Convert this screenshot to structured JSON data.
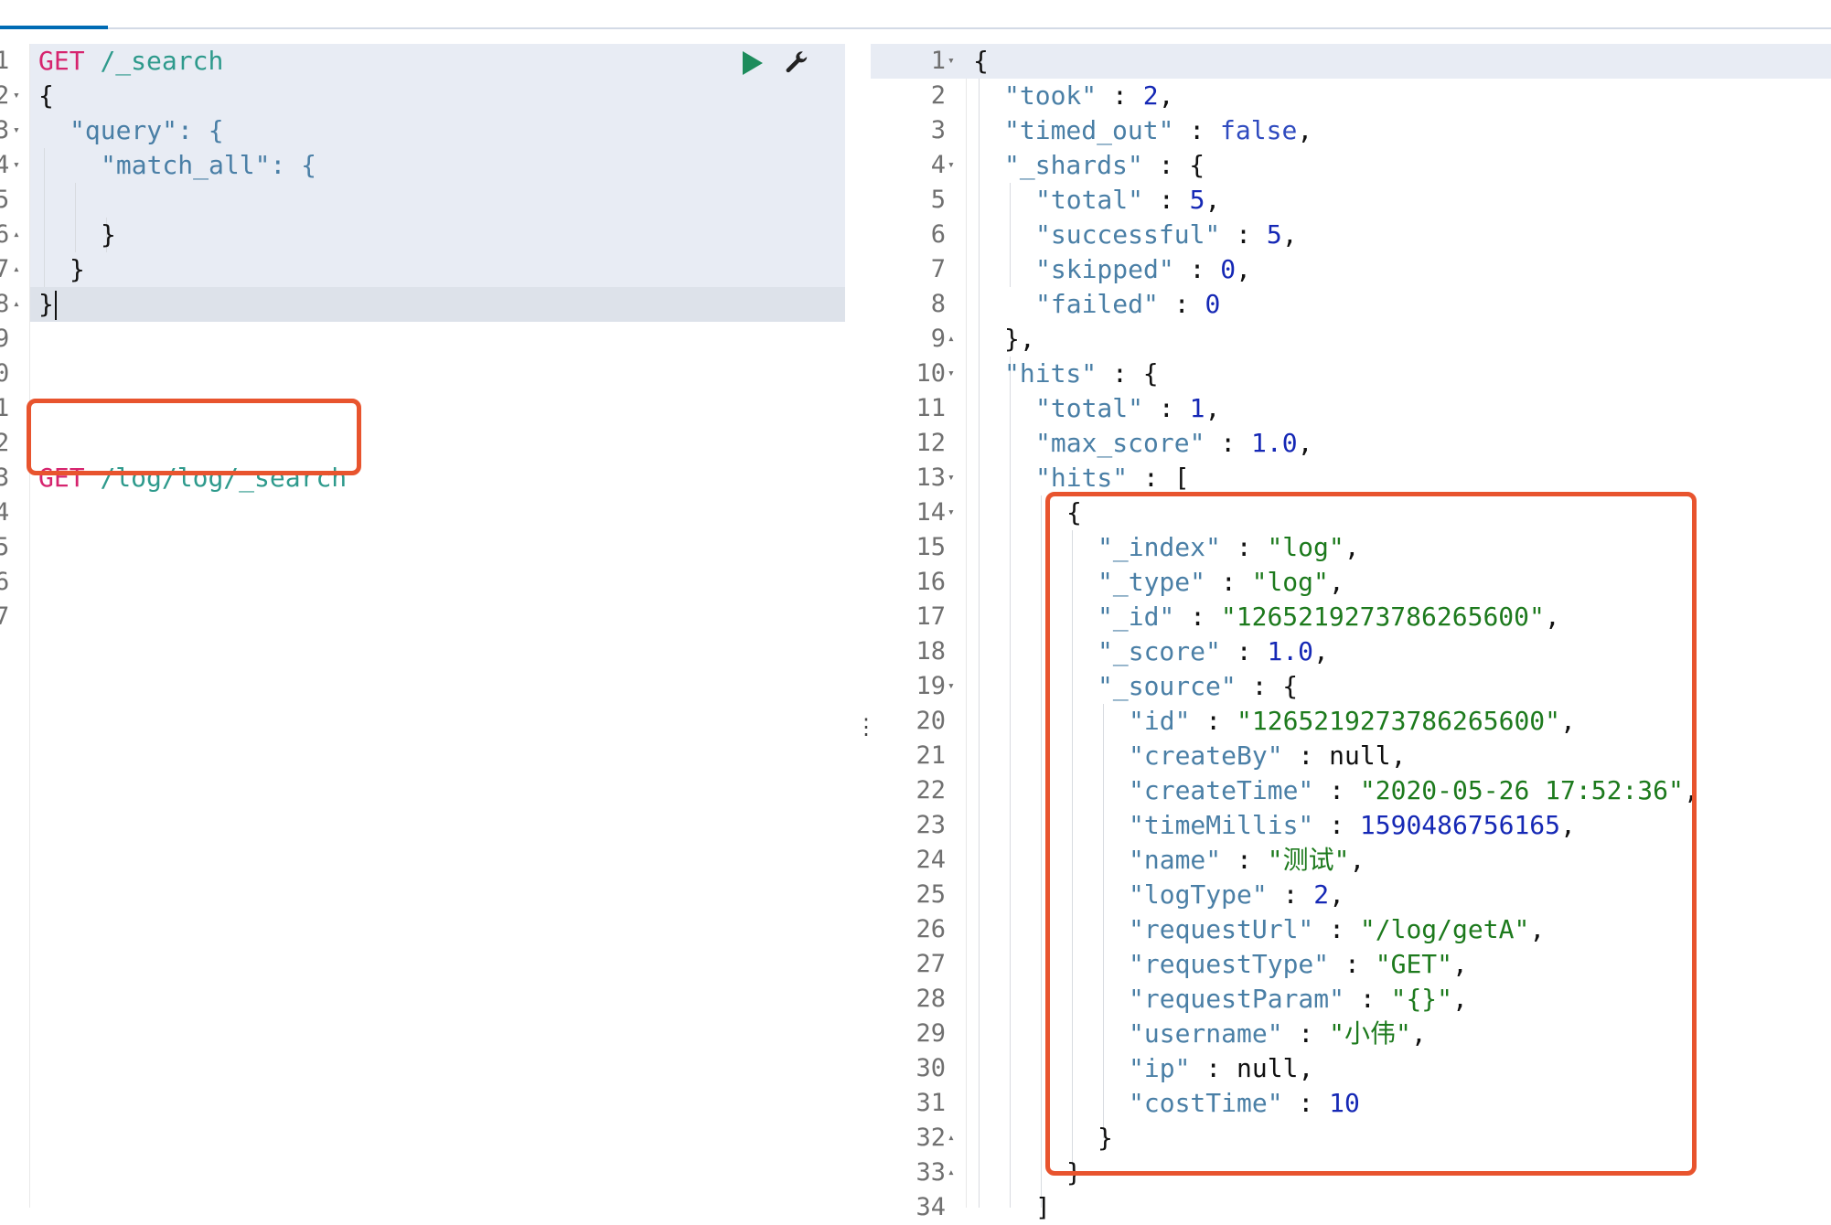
{
  "left_editor": {
    "gutter_numbers": [
      "1",
      "2",
      "3",
      "4",
      "5",
      "6",
      "7",
      "8",
      "9",
      "0",
      "1",
      "2",
      "3",
      "4",
      "5",
      "6",
      "7"
    ],
    "request1": {
      "method": "GET",
      "path": "/_search",
      "lines": [
        "{",
        "\"query\": {",
        "\"match_all\": {",
        "",
        "}",
        "}",
        "}"
      ]
    },
    "request2": {
      "method": "GET",
      "path": "/log/log/_search"
    },
    "icons": [
      "run-icon",
      "wrench-icon"
    ]
  },
  "right_editor": {
    "line_numbers": [
      "1",
      "2",
      "3",
      "4",
      "5",
      "6",
      "7",
      "8",
      "9",
      "10",
      "11",
      "12",
      "13",
      "14",
      "15",
      "16",
      "17",
      "18",
      "19",
      "20",
      "21",
      "22",
      "23",
      "24",
      "25",
      "26",
      "27",
      "28",
      "29",
      "30",
      "31",
      "32",
      "33",
      "34"
    ],
    "response": {
      "took": "2",
      "timed_out": "false",
      "shards_total": "5",
      "shards_successful": "5",
      "shards_skipped": "0",
      "shards_failed": "0",
      "hits_total": "1",
      "max_score": "1.0",
      "hit": {
        "_index": "\"log\"",
        "_type": "\"log\"",
        "_id": "\"1265219273786265600\"",
        "_score": "1.0",
        "source": {
          "id": "\"1265219273786265600\"",
          "createBy": "null",
          "createTime": "\"2020-05-26 17:52:36\"",
          "timeMillis": "1590486756165",
          "name": "\"测试\"",
          "logType": "2",
          "requestUrl": "\"/log/getA\"",
          "requestType": "\"GET\"",
          "requestParam": "\"{}\"",
          "username": "\"小伟\"",
          "ip": "null",
          "costTime": "10"
        }
      }
    }
  },
  "colors": {
    "annotation": "#e8542e",
    "method": "#d6246e",
    "path": "#2e9a8c",
    "string": "#1d7a1d",
    "number": "#1528b5"
  }
}
